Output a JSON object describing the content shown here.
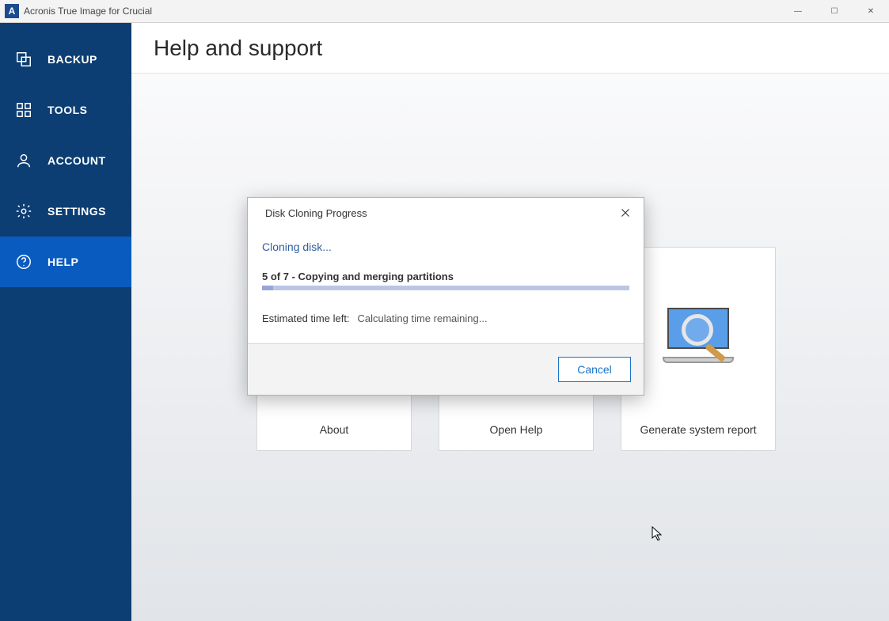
{
  "app": {
    "title": "Acronis True Image for Crucial",
    "logo_letter": "A"
  },
  "window_controls": {
    "minimize": "—",
    "maximize": "☐",
    "close": "✕"
  },
  "sidebar": {
    "items": [
      {
        "label": "BACKUP",
        "icon": "backup-icon",
        "active": false
      },
      {
        "label": "TOOLS",
        "icon": "tools-icon",
        "active": false
      },
      {
        "label": "ACCOUNT",
        "icon": "account-icon",
        "active": false
      },
      {
        "label": "SETTINGS",
        "icon": "settings-icon",
        "active": false
      },
      {
        "label": "HELP",
        "icon": "help-icon",
        "active": true
      }
    ]
  },
  "page": {
    "title": "Help and support"
  },
  "cards": [
    {
      "label": "About"
    },
    {
      "label": "Open Help"
    },
    {
      "label": "Generate system report"
    }
  ],
  "modal": {
    "title": "Disk Cloning Progress",
    "status": "Cloning disk...",
    "step_text": "5 of 7 - Copying and merging partitions",
    "progress_percent": 3,
    "estimated_label": "Estimated time left:",
    "estimated_value": "Calculating time remaining...",
    "cancel_label": "Cancel"
  }
}
